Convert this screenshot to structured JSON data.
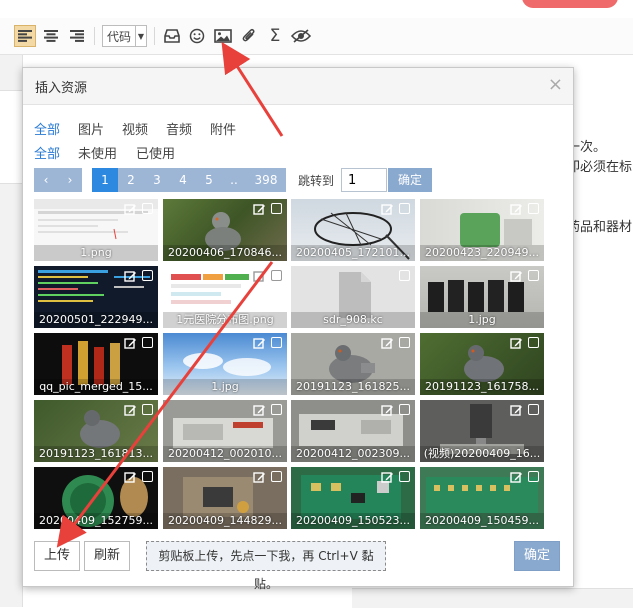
{
  "toolbar": {
    "code_label": "代码",
    "icons": [
      "align-left-icon",
      "align-center-icon",
      "align-right-icon",
      "inbox-icon",
      "smiley-icon",
      "image-icon",
      "paperclip-icon",
      "sigma-icon",
      "eye-icon"
    ]
  },
  "background_text": [
    "一次。",
    "卽必须在标",
    "药品和器材"
  ],
  "dialog": {
    "title": "插入资源",
    "close": "×",
    "type_filters": [
      "全部",
      "图片",
      "视频",
      "音频",
      "附件"
    ],
    "usage_filters": [
      "全部",
      "未使用",
      "已使用"
    ],
    "pagination": {
      "prev": "‹",
      "next": "›",
      "pages": [
        "1",
        "2",
        "3",
        "4",
        "5",
        "..",
        "398"
      ],
      "current": "1",
      "jump_label": "跳转到",
      "jump_value": "1",
      "jump_button": "确定"
    },
    "resources": [
      {
        "label": "1.png"
      },
      {
        "label": "20200406_170846..."
      },
      {
        "label": "20200405_172101..."
      },
      {
        "label": "20200423_220949..."
      },
      {
        "label": "20200501_222949..."
      },
      {
        "label": "1元医院分布图.png"
      },
      {
        "label": "sdr_908.kc"
      },
      {
        "label": "1.jpg"
      },
      {
        "label": "qq_pic_merged_15..."
      },
      {
        "label": "1.jpg"
      },
      {
        "label": "20191123_161825..."
      },
      {
        "label": "20191123_161758..."
      },
      {
        "label": "20191123_161813..."
      },
      {
        "label": "20200412_002010..."
      },
      {
        "label": "20200412_002309..."
      },
      {
        "label": "(视频)20200409_16..."
      },
      {
        "label": "20200409_152759..."
      },
      {
        "label": "20200409_144829..."
      },
      {
        "label": "20200409_150523..."
      },
      {
        "label": "20200409_150459..."
      }
    ],
    "upload_button": "上传",
    "refresh_button": "刷新",
    "paste_hint": "剪贴板上传，先点一下我，再 Ctrl+V 黏贴。",
    "confirm_button": "确定"
  },
  "colors": {
    "active_filter": "#2a7bd4",
    "current_page": "#2d89e0",
    "page_button": "#9db6d6",
    "confirm_button": "#8aa9cf",
    "annotation_arrow": "#e8413c"
  }
}
